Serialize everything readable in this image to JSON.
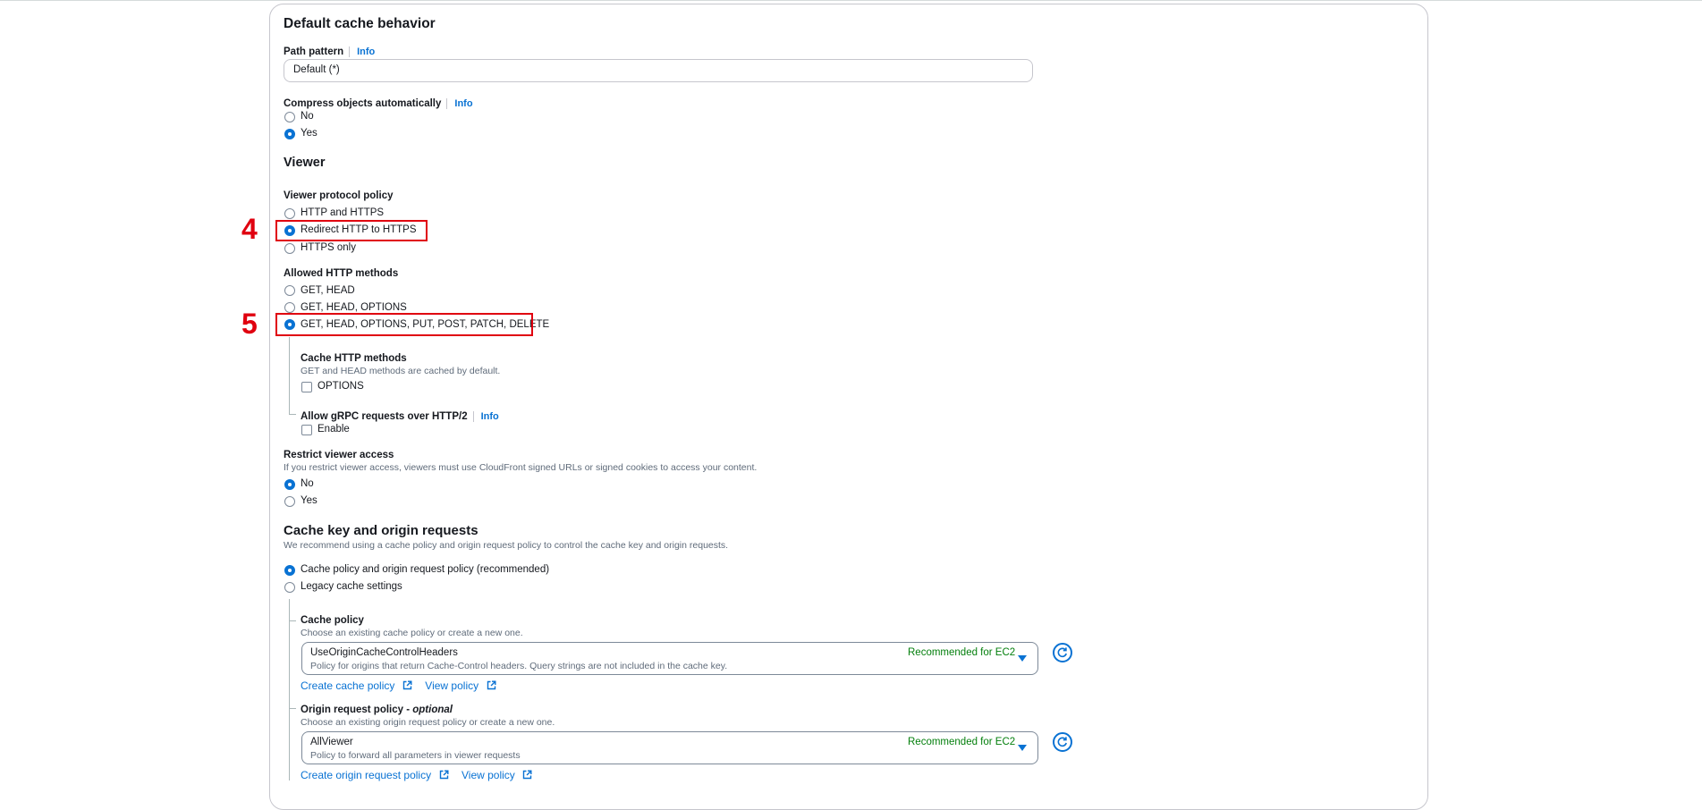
{
  "section_title": "Default cache behavior",
  "path_pattern": {
    "label": "Path pattern",
    "info": "Info",
    "value": "Default (*)"
  },
  "compress": {
    "label": "Compress objects automatically",
    "info": "Info",
    "options": [
      "No",
      "Yes"
    ],
    "selected": "Yes"
  },
  "viewer": {
    "heading": "Viewer"
  },
  "viewer_protocol": {
    "label": "Viewer protocol policy",
    "options": [
      "HTTP and HTTPS",
      "Redirect HTTP to HTTPS",
      "HTTPS only"
    ],
    "selected": "Redirect HTTP to HTTPS"
  },
  "allowed_methods": {
    "label": "Allowed HTTP methods",
    "options": [
      "GET, HEAD",
      "GET, HEAD, OPTIONS",
      "GET, HEAD, OPTIONS, PUT, POST, PATCH, DELETE"
    ],
    "selected": "GET, HEAD, OPTIONS, PUT, POST, PATCH, DELETE"
  },
  "cache_methods": {
    "label": "Cache HTTP methods",
    "description": "GET and HEAD methods are cached by default.",
    "checkbox": "OPTIONS"
  },
  "grpc": {
    "label": "Allow gRPC requests over HTTP/2",
    "info": "Info",
    "checkbox": "Enable"
  },
  "restrict": {
    "label": "Restrict viewer access",
    "description": "If you restrict viewer access, viewers must use CloudFront signed URLs or signed cookies to access your content.",
    "options": [
      "No",
      "Yes"
    ],
    "selected": "No"
  },
  "cache_key": {
    "heading": "Cache key and origin requests",
    "description": "We recommend using a cache policy and origin request policy to control the cache key and origin requests.",
    "options": [
      "Cache policy and origin request policy (recommended)",
      "Legacy cache settings"
    ],
    "selected": "Cache policy and origin request policy (recommended)"
  },
  "cache_policy": {
    "label": "Cache policy",
    "description": "Choose an existing cache policy or create a new one.",
    "selected_name": "UseOriginCacheControlHeaders",
    "selected_desc": "Policy for origins that return Cache-Control headers. Query strings are not included in the cache key.",
    "badge": "Recommended for EC2",
    "create_link": "Create cache policy",
    "view_link": "View policy"
  },
  "origin_policy": {
    "label": "Origin request policy - ",
    "label_optional": "optional",
    "description": "Choose an existing origin request policy or create a new one.",
    "selected_name": "AllViewer",
    "selected_desc": "Policy to forward all parameters in viewer requests",
    "badge": "Recommended for EC2",
    "create_link": "Create origin request policy",
    "view_link": "View policy"
  },
  "annotations": {
    "step4": "4",
    "step5": "5"
  },
  "colors": {
    "accent": "#0972d3",
    "highlight": "#e0000f",
    "recommended": "#037f0c"
  }
}
